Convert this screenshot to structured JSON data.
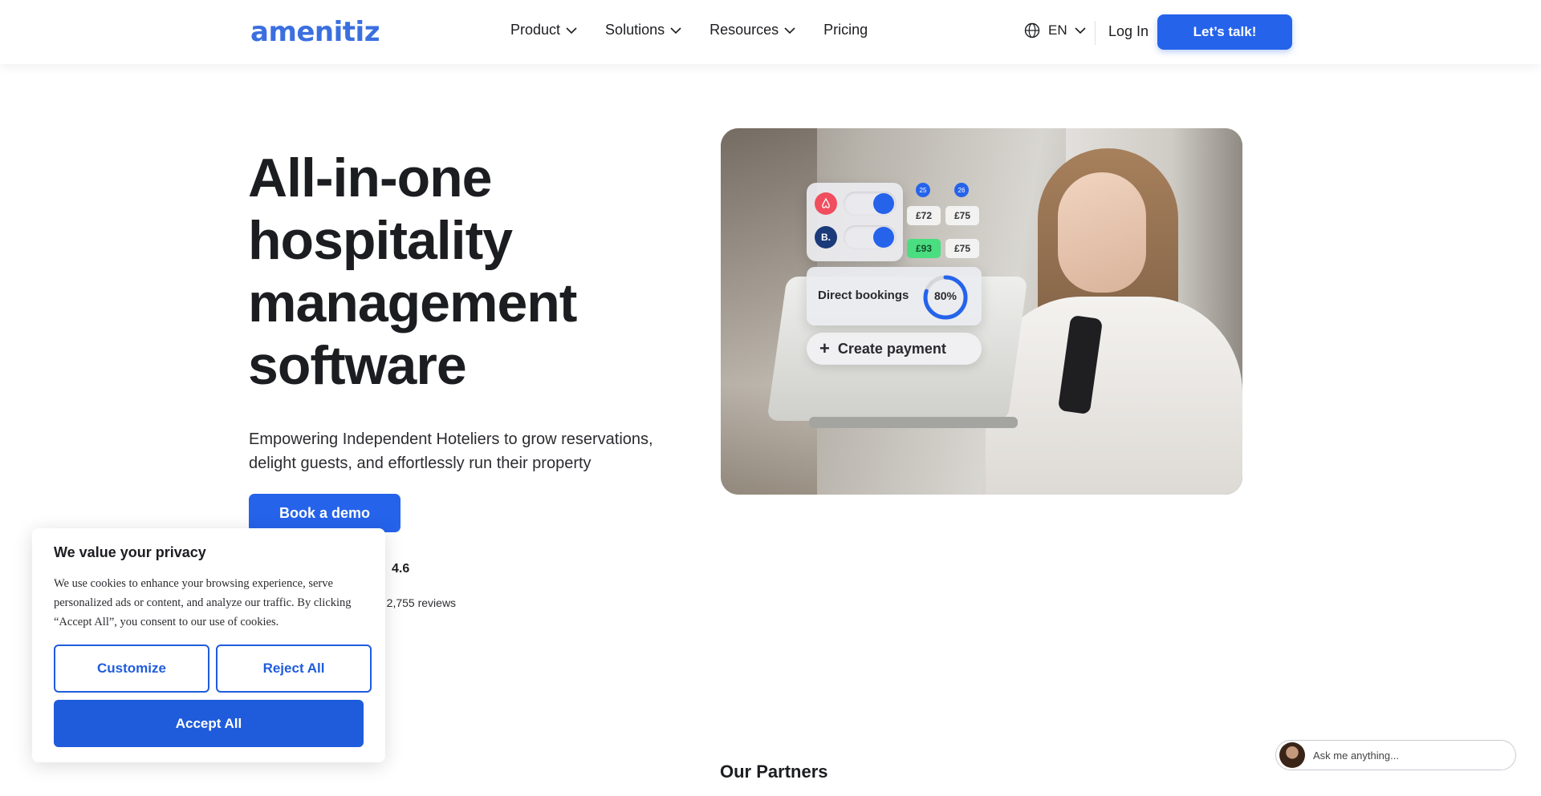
{
  "nav": {
    "logo": "amenitiz",
    "menu": [
      {
        "label": "Product",
        "has_dropdown": true
      },
      {
        "label": "Solutions",
        "has_dropdown": true
      },
      {
        "label": "Resources",
        "has_dropdown": true
      },
      {
        "label": "Pricing",
        "has_dropdown": false
      }
    ],
    "language": "EN",
    "login": "Log In",
    "cta": "Let’s talk!"
  },
  "hero": {
    "title_lines": [
      "All-in-one",
      "hospitality",
      "management",
      "software"
    ],
    "subtitle": "Empowering Independent Hoteliers to grow reservations, delight guests, and effortlessly run their property",
    "demo_button": "Book a demo",
    "rating_score": "4.6",
    "reviews_text": "n 2,755 reviews"
  },
  "hero_image": {
    "channel_badges": [
      "",
      "B."
    ],
    "dates": [
      "25",
      "26"
    ],
    "prices_row1": [
      "£72",
      "£75"
    ],
    "prices_row2": [
      "£93",
      "£75"
    ],
    "direct_label": "Direct bookings",
    "direct_pct": "80%",
    "direct_value": 0.8,
    "payment_label": "Create payment",
    "accent": "#2563eb"
  },
  "partners": {
    "heading": "Our Partners"
  },
  "cookie": {
    "title": "We value your privacy",
    "body": "We use cookies to enhance your browsing experience, serve personalized ads or content, and analyze our traffic. By clicking “Accept All”, you consent to our use of cookies.",
    "customize": "Customize",
    "reject": "Reject All",
    "accept": "Accept All"
  },
  "chat": {
    "placeholder": "Ask me anything..."
  }
}
